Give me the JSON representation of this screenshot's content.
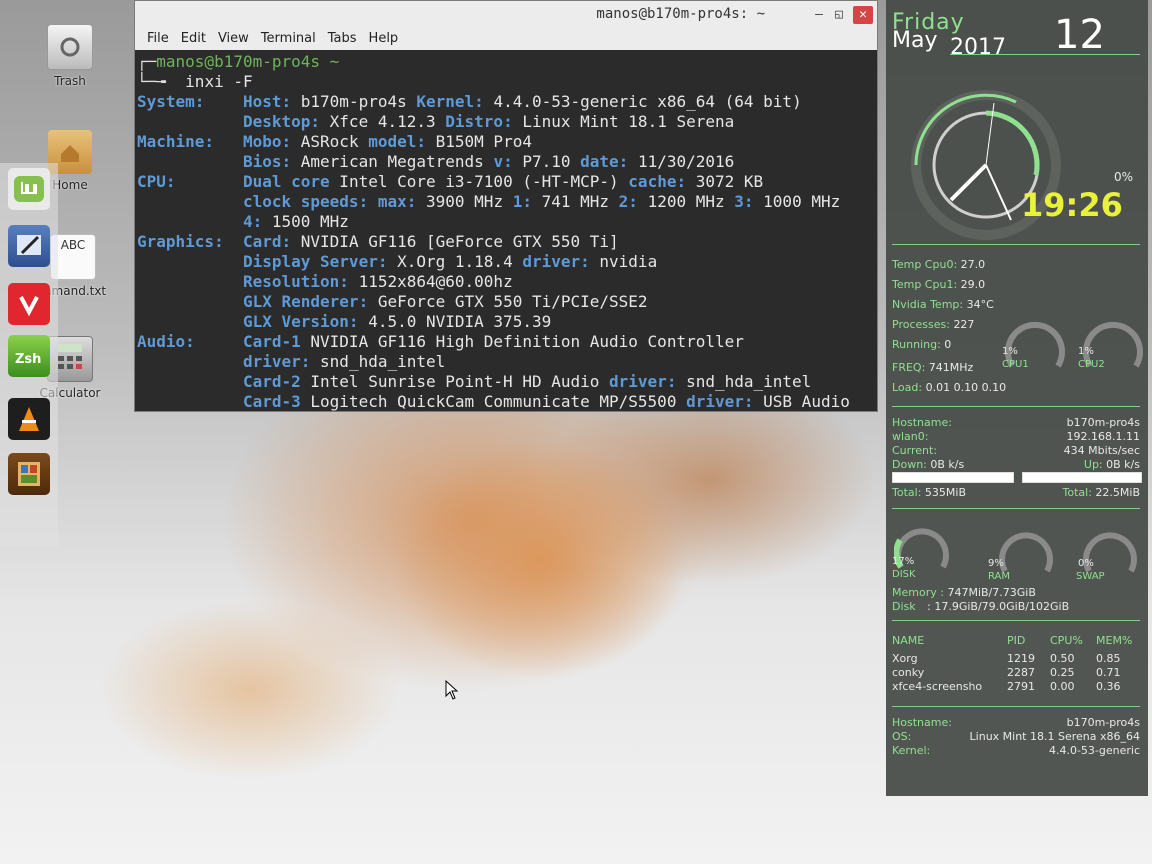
{
  "desktop": {
    "trash_label": "Trash",
    "home_label": "Home",
    "command_txt_label": "mmand.txt",
    "calculator_label": "Calculator"
  },
  "terminal": {
    "title": "manos@b170m-pro4s: ~",
    "menu": [
      "File",
      "Edit",
      "View",
      "Terminal",
      "Tabs",
      "Help"
    ],
    "prompt_user": "manos@b170m-pro4s ~",
    "command": "inxi -F",
    "lines": [
      [
        [
          "k",
          "System:    "
        ],
        [
          "k",
          "Host:"
        ],
        [
          "t",
          " b170m-pro4s "
        ],
        [
          "k",
          "Kernel:"
        ],
        [
          "t",
          " 4.4.0-53-generic x86_64 (64 bit)"
        ]
      ],
      [
        [
          "t",
          "           "
        ],
        [
          "k",
          "Desktop:"
        ],
        [
          "t",
          " Xfce 4.12.3 "
        ],
        [
          "k",
          "Distro:"
        ],
        [
          "t",
          " Linux Mint 18.1 Serena"
        ]
      ],
      [
        [
          "k",
          "Machine:   "
        ],
        [
          "k",
          "Mobo:"
        ],
        [
          "t",
          " ASRock "
        ],
        [
          "k",
          "model:"
        ],
        [
          "t",
          " B150M Pro4"
        ]
      ],
      [
        [
          "t",
          "           "
        ],
        [
          "k",
          "Bios:"
        ],
        [
          "t",
          " American Megatrends "
        ],
        [
          "k",
          "v:"
        ],
        [
          "t",
          " P7.10 "
        ],
        [
          "k",
          "date:"
        ],
        [
          "t",
          " 11/30/2016"
        ]
      ],
      [
        [
          "k",
          "CPU:       "
        ],
        [
          "k",
          "Dual core"
        ],
        [
          "t",
          " Intel Core i3-7100 (-HT-MCP-) "
        ],
        [
          "k",
          "cache:"
        ],
        [
          "t",
          " 3072 KB"
        ]
      ],
      [
        [
          "t",
          "           "
        ],
        [
          "k",
          "clock speeds:"
        ],
        [
          "t",
          " "
        ],
        [
          "k",
          "max:"
        ],
        [
          "t",
          " 3900 MHz "
        ],
        [
          "k",
          "1:"
        ],
        [
          "t",
          " 741 MHz "
        ],
        [
          "k",
          "2:"
        ],
        [
          "t",
          " 1200 MHz "
        ],
        [
          "k",
          "3:"
        ],
        [
          "t",
          " 1000 MHz"
        ]
      ],
      [
        [
          "t",
          "           "
        ],
        [
          "k",
          "4:"
        ],
        [
          "t",
          " 1500 MHz"
        ]
      ],
      [
        [
          "k",
          "Graphics:  "
        ],
        [
          "k",
          "Card:"
        ],
        [
          "t",
          " NVIDIA GF116 [GeForce GTX 550 Ti]"
        ]
      ],
      [
        [
          "t",
          "           "
        ],
        [
          "k",
          "Display Server:"
        ],
        [
          "t",
          " X.Org 1.18.4 "
        ],
        [
          "k",
          "driver:"
        ],
        [
          "t",
          " nvidia"
        ]
      ],
      [
        [
          "t",
          "           "
        ],
        [
          "k",
          "Resolution:"
        ],
        [
          "t",
          " 1152x864@60.00hz"
        ]
      ],
      [
        [
          "t",
          "           "
        ],
        [
          "k",
          "GLX Renderer:"
        ],
        [
          "t",
          " GeForce GTX 550 Ti/PCIe/SSE2"
        ]
      ],
      [
        [
          "t",
          "           "
        ],
        [
          "k",
          "GLX Version:"
        ],
        [
          "t",
          " 4.5.0 NVIDIA 375.39"
        ]
      ],
      [
        [
          "k",
          "Audio:     "
        ],
        [
          "k",
          "Card-1"
        ],
        [
          "t",
          " NVIDIA GF116 High Definition Audio Controller"
        ]
      ],
      [
        [
          "t",
          "           "
        ],
        [
          "k",
          "driver:"
        ],
        [
          "t",
          " snd_hda_intel"
        ]
      ],
      [
        [
          "t",
          "           "
        ],
        [
          "k",
          "Card-2"
        ],
        [
          "t",
          " Intel Sunrise Point-H HD Audio "
        ],
        [
          "k",
          "driver:"
        ],
        [
          "t",
          " snd_hda_intel"
        ]
      ],
      [
        [
          "t",
          "           "
        ],
        [
          "k",
          "Card-3"
        ],
        [
          "t",
          " Logitech QuickCam Communicate MP/S5500 "
        ],
        [
          "k",
          "driver:"
        ],
        [
          "t",
          " USB Audio"
        ]
      ]
    ]
  },
  "conky": {
    "day": "Friday",
    "month": "May",
    "year": "2017",
    "date": "12",
    "cpu_pct_top": "0%",
    "time": "19:26",
    "temp_cpu0_label": "Temp Cpu0:",
    "temp_cpu0": "27.0",
    "temp_cpu1_label": "Temp Cpu1:",
    "temp_cpu1": "29.0",
    "nvidia_temp_label": "Nvidia Temp:",
    "nvidia_temp": "34°C",
    "processes_label": "Processes:",
    "processes": "227",
    "running_label": "Running:",
    "running": "0",
    "freq_label": "FREQ:",
    "freq": "741MHz",
    "load_label": "Load:",
    "load": "0.01 0.10 0.10",
    "cpu1_pct": "1%",
    "cpu1_label": "CPU1",
    "cpu2_pct": "1%",
    "cpu2_label": "CPU2",
    "hostname_label": "Hostname:",
    "hostname": "b170m-pro4s",
    "wlan_label": "wlan0:",
    "wlan_ip": "192.168.1.11",
    "current_label": "Current:",
    "current": "434  Mbits/sec",
    "down_label": "Down:",
    "down": "0B k/s",
    "up_label": "Up:",
    "up": "0B k/s",
    "total_down_label": "Total:",
    "total_down": "535MiB",
    "total_up_label": "Total:",
    "total_up": "22.5MiB",
    "disk_pct": "17%",
    "disk_label": "DISK",
    "ram_pct": "9%",
    "ram_label": "RAM",
    "swap_pct": "0%",
    "swap_label": "SWAP",
    "memory_label": "Memory :",
    "memory": "747MiB/7.73GiB",
    "disk_info_label": "Disk",
    "disk_info": ": 17.9GiB/79.0GiB/102GiB",
    "proc_headers": [
      "NAME",
      "PID",
      "CPU%",
      "MEM%"
    ],
    "procs": [
      [
        "Xorg",
        "1219",
        "0.50",
        "0.85"
      ],
      [
        "conky",
        "2287",
        "0.25",
        "0.71"
      ],
      [
        "xfce4-screensho",
        "2791",
        "0.00",
        "0.36"
      ]
    ],
    "host2_label": "Hostname:",
    "host2": "b170m-pro4s",
    "os_label": "OS:",
    "os": "Linux Mint 18.1 Serena x86_64",
    "kernel_label": "Kernel:",
    "kernel": "4.4.0-53-generic"
  }
}
